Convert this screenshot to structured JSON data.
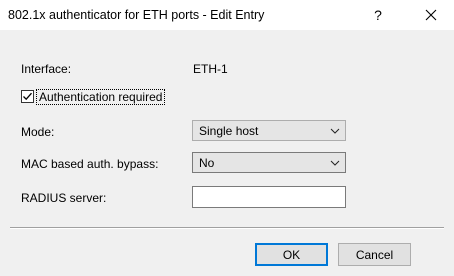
{
  "window": {
    "title": "802.1x authenticator for ETH ports - Edit Entry",
    "help_label": "?"
  },
  "form": {
    "interface_label": "Interface:",
    "interface_value": "ETH-1",
    "auth_required_label": "Authentication required",
    "auth_required_checked": true,
    "mode_label": "Mode:",
    "mode_value": "Single host",
    "mac_bypass_label": "MAC based auth. bypass:",
    "mac_bypass_value": "No",
    "radius_label": "RADIUS server:",
    "radius_value": ""
  },
  "buttons": {
    "ok_label": "OK",
    "cancel_label": "Cancel"
  },
  "icons": {
    "close": "close-icon",
    "check": "check-icon",
    "dropdown": "chevron-down-icon"
  }
}
